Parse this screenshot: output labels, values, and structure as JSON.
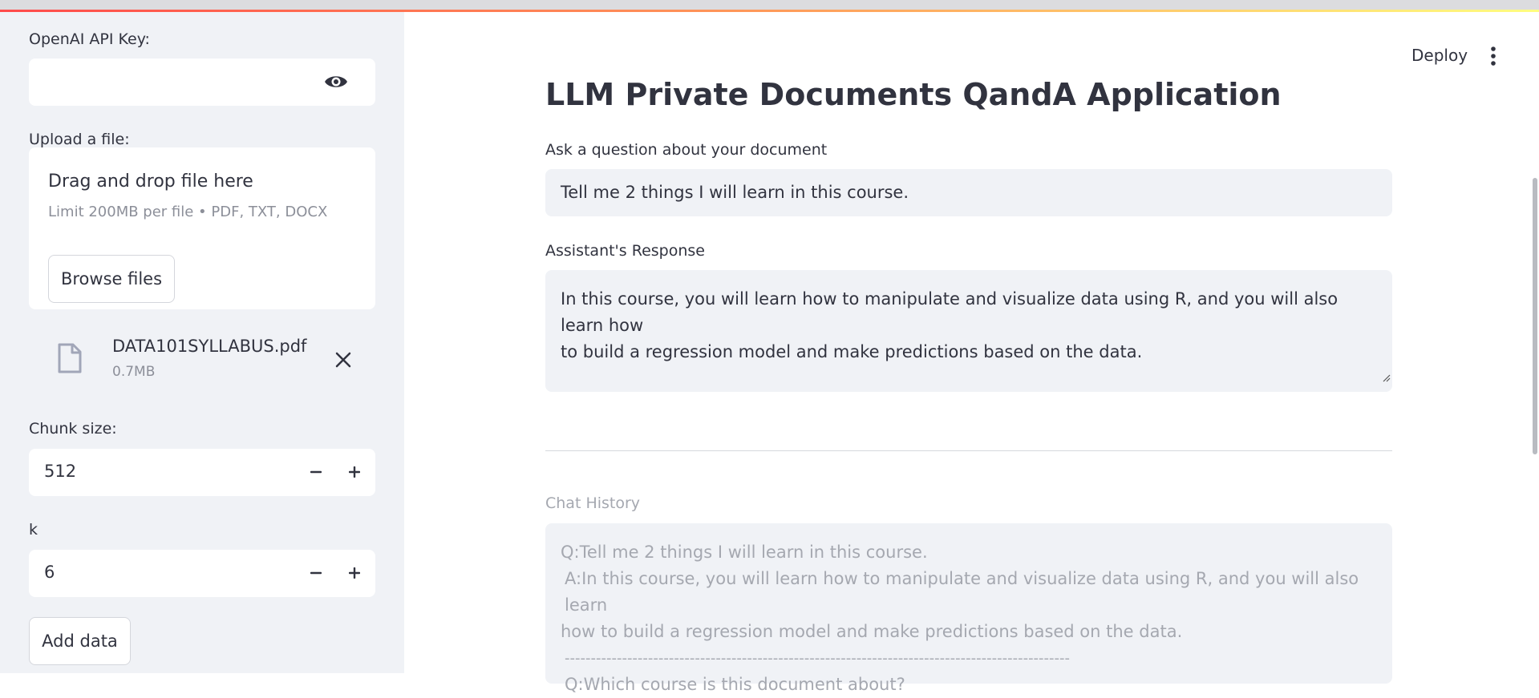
{
  "sidebar": {
    "api_key_label": "OpenAI API Key:",
    "upload_label": "Upload a file:",
    "uploader": {
      "drag_text": "Drag and drop file here",
      "limit_text": "Limit 200MB per file • PDF, TXT, DOCX",
      "browse_label": "Browse files"
    },
    "file": {
      "name": "DATA101SYLLABUS.pdf",
      "size": "0.7MB"
    },
    "chunk_size": {
      "label": "Chunk size:",
      "value": "512"
    },
    "k": {
      "label": "k",
      "value": "6"
    },
    "add_data_label": "Add data"
  },
  "header": {
    "deploy_label": "Deploy"
  },
  "main": {
    "title": "LLM Private Documents QandA Application",
    "question_label": "Ask a question about your document",
    "question_value": "Tell me 2 things I will learn in this course.",
    "response_label": "Assistant's Response",
    "response_line1": "In this course, you will learn how to manipulate and visualize data using R, and you will also learn how",
    "response_line2": "to build a regression model and make predictions based on the data.",
    "history_label": "Chat History",
    "history_line1": "Q:Tell me 2 things I will learn in this course.",
    "history_line2": "A:In this course, you will learn how to manipulate and visualize data using R, and you will also learn",
    "history_line3": "how to build a regression model and make predictions based on the data.",
    "history_sep": "-------------------------------------------------------------------------------------------------",
    "history_line4": "Q:Which course is this document about?"
  },
  "colors": {
    "sidebar_bg": "#f0f2f6",
    "text": "#31333f",
    "muted": "#8c8f99",
    "accent_gradient": [
      "#ff4b4b",
      "#fffd80"
    ]
  },
  "icons": [
    "eye-icon",
    "file-icon",
    "close-icon",
    "minus-icon",
    "plus-icon",
    "kebab-menu-icon",
    "resize-handle-icon"
  ]
}
